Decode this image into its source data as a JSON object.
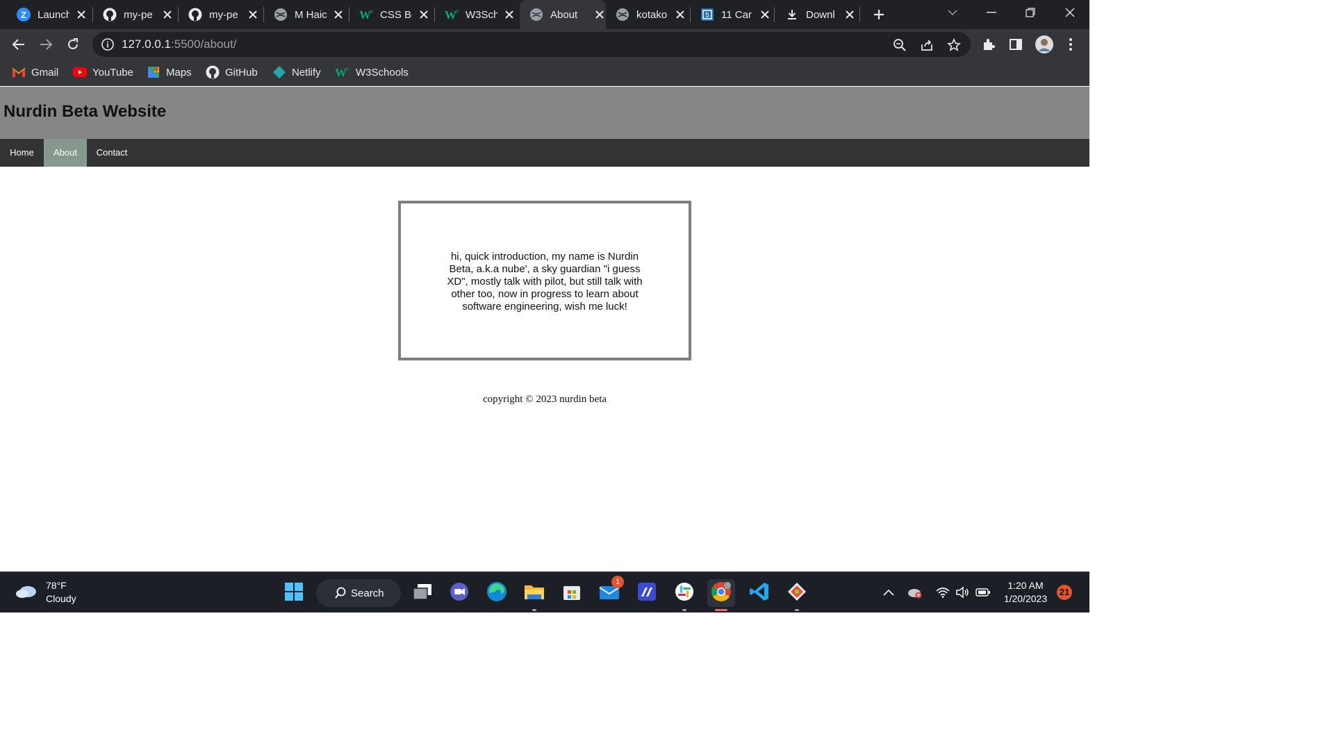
{
  "browser": {
    "tabs": [
      {
        "title": "Launch",
        "icon": "zoom-icon"
      },
      {
        "title": "my-pe",
        "icon": "github-icon"
      },
      {
        "title": "my-pe",
        "icon": "github-icon"
      },
      {
        "title": "M Haic",
        "icon": "globe-icon"
      },
      {
        "title": "CSS Bo",
        "icon": "w3schools-icon"
      },
      {
        "title": "W3Sch",
        "icon": "w3schools-icon"
      },
      {
        "title": "About",
        "icon": "globe-icon",
        "active": true
      },
      {
        "title": "kotako",
        "icon": "globe-icon"
      },
      {
        "title": "11 Car",
        "icon": "bookmark-site-icon"
      },
      {
        "title": "Downl",
        "icon": "download-icon"
      }
    ],
    "url_host": "127.0.0.1",
    "url_rest": ":5500/about/",
    "bookmarks": [
      {
        "label": "Gmail",
        "icon": "gmail-icon"
      },
      {
        "label": "YouTube",
        "icon": "youtube-icon"
      },
      {
        "label": "Maps",
        "icon": "maps-icon"
      },
      {
        "label": "GitHub",
        "icon": "github-icon"
      },
      {
        "label": "Netlify",
        "icon": "netlify-icon"
      },
      {
        "label": "W3Schools",
        "icon": "w3schools-icon"
      }
    ]
  },
  "site": {
    "title": "Nurdin Beta Website",
    "nav": [
      {
        "label": "Home"
      },
      {
        "label": "About",
        "current": true
      },
      {
        "label": "Contact"
      }
    ],
    "intro": "hi, quick introduction, my name is Nurdin Beta, a.k.a nube', a sky guardian \"i guess XD\", mostly talk with pilot, but still talk with other too, now in progress to learn about software engineering, wish me luck!",
    "copyright": "copyright © 2023 nurdin beta"
  },
  "taskbar": {
    "weather_temp": "78°F",
    "weather_desc": "Cloudy",
    "search_label": "Search",
    "mail_badge": "1",
    "time": "1:20 AM",
    "date": "1/20/2023",
    "notifications": "21"
  },
  "colors": {
    "header_bg": "#868686",
    "nav_bg": "#333333",
    "nav_active": "#87998f",
    "box_border": "#7f7f7f"
  }
}
